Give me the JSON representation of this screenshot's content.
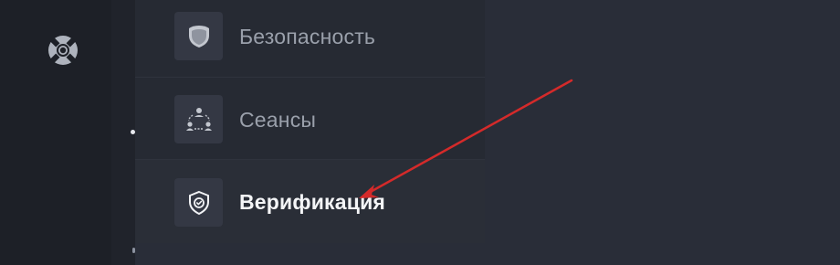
{
  "rail": {
    "icon": "lifebuoy-icon"
  },
  "menu": {
    "items": [
      {
        "label": "Безопасность",
        "icon": "shield-icon",
        "active": false
      },
      {
        "label": "Сеансы",
        "icon": "network-sessions-icon",
        "active": false
      },
      {
        "label": "Верификация",
        "icon": "verified-shield-icon",
        "active": true
      }
    ]
  },
  "annotation": {
    "type": "arrow",
    "color": "#d42a2a",
    "points_to": "menu.items.2"
  },
  "colors": {
    "background": "#292d38",
    "rail": "#1d2027",
    "menu": "#262a33",
    "icon_tile": "#343844",
    "label_muted": "#9aa0ab",
    "label_active": "#f4f5f7"
  }
}
